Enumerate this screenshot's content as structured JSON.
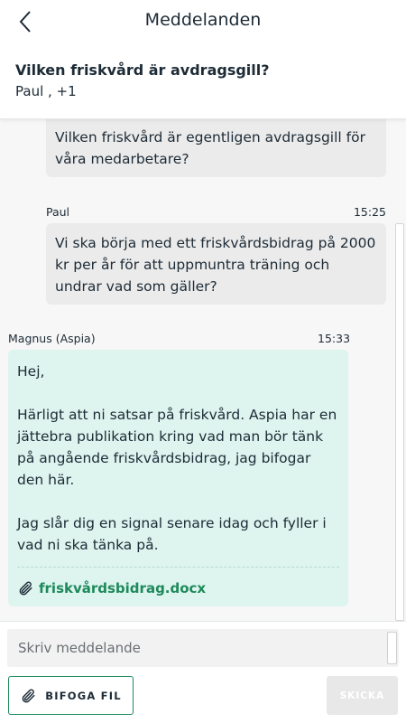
{
  "topbar": {
    "title": "Meddelanden",
    "back_icon": "chevron-left-icon"
  },
  "thread": {
    "title": "Vilken friskvård är avdragsgill?",
    "participants": "Paul ,  +1"
  },
  "messages": [
    {
      "direction": "outgoing",
      "text": "Vilken friskvård är egentligen avdragsgill för våra medarbetare?"
    },
    {
      "direction": "outgoing",
      "sender": "Paul",
      "time": "15:25",
      "text": "Vi ska börja med ett friskvårdsbidrag på 2000 kr per år för att uppmuntra träning och undrar vad som gäller?"
    },
    {
      "direction": "incoming",
      "sender": "Magnus (Aspia)",
      "time": "15:33",
      "text": "Hej,\n\nHärligt att ni satsar på friskvård. Aspia har en jättebra publikation kring vad man bör tänk på angående friskvårdsbidrag, jag bifogar den här.\n\nJag slår dig en signal senare idag och fyller i vad ni ska tänka på.",
      "attachment": {
        "icon": "paperclip-icon",
        "filename": "friskvårdsbidrag.docx"
      }
    }
  ],
  "composer": {
    "placeholder": "Skriv meddelande",
    "attach_label": "BIFOGA FIL",
    "send_label": "SKICKA"
  },
  "colors": {
    "accent": "#1e8a5b",
    "incoming_bubble": "#ddf4ef",
    "outgoing_bubble": "#ebebeb"
  }
}
